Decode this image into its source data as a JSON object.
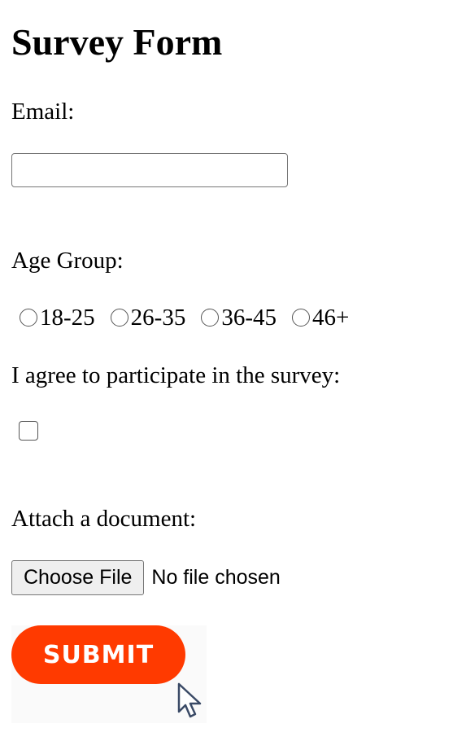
{
  "form": {
    "title": "Survey Form",
    "email": {
      "label": "Email:",
      "value": "",
      "placeholder": ""
    },
    "age_group": {
      "label": "Age Group:",
      "options": [
        "18-25",
        "26-35",
        "36-45",
        "46+"
      ],
      "selected": null
    },
    "consent": {
      "label": "I agree to participate in the survey:",
      "checked": false
    },
    "attachment": {
      "label": "Attach a document:",
      "button_label": "Choose File",
      "status": "No file chosen"
    },
    "submit": {
      "label": "SUBMIT"
    }
  },
  "colors": {
    "submit_background": "#ff3a00",
    "submit_text": "#ffffff",
    "file_button_background": "#efefef",
    "control_border": "#767676"
  },
  "icons": {
    "pointer": "mouse-pointer-icon"
  }
}
